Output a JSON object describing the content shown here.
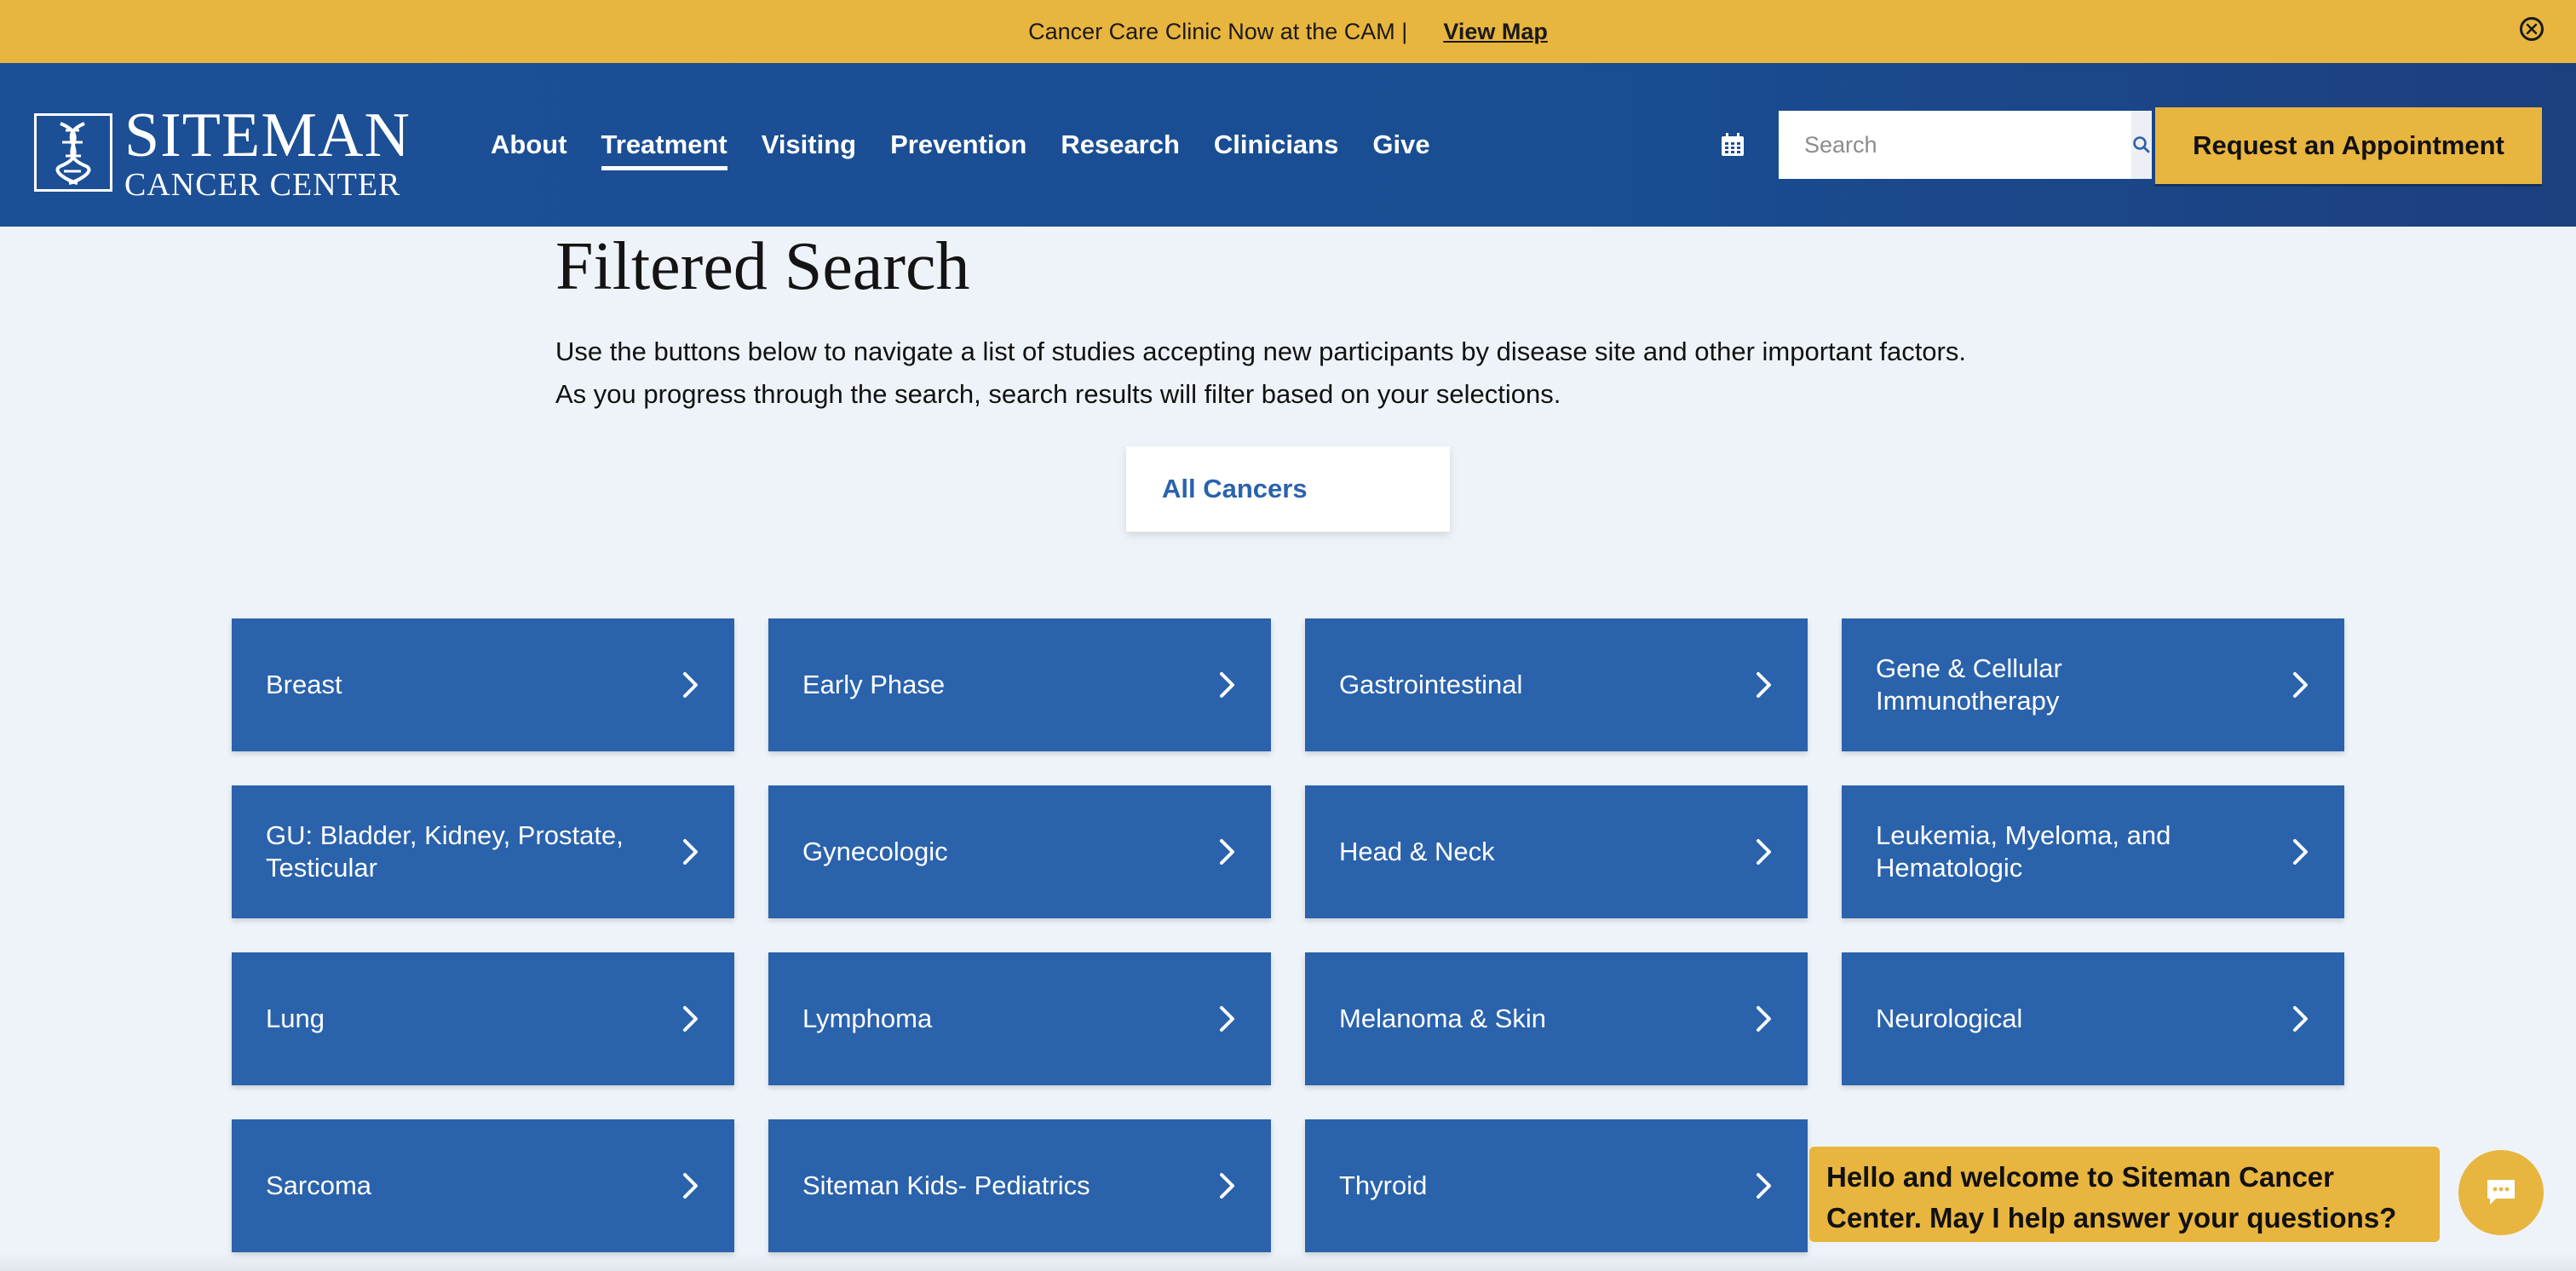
{
  "announcement": {
    "message": "Cancer Care Clinic Now at the CAM |",
    "link_label": "View Map"
  },
  "header": {
    "logo_line1": "SITEMAN",
    "logo_line2": "CANCER CENTER",
    "nav": [
      {
        "label": "About"
      },
      {
        "label": "Treatment",
        "active": true
      },
      {
        "label": "Visiting"
      },
      {
        "label": "Prevention"
      },
      {
        "label": "Research"
      },
      {
        "label": "Clinicians"
      },
      {
        "label": "Give"
      }
    ],
    "search_placeholder": "Search",
    "appointment_label": "Request an Appointment"
  },
  "main": {
    "title": "Filtered Search",
    "description": "Use the buttons below to navigate a list of studies accepting new participants by disease site and other important factors. As you progress through the search, search results will filter based on your selections.",
    "all_cancers_label": "All Cancers",
    "tiles": [
      {
        "label": "Breast"
      },
      {
        "label": "Early Phase"
      },
      {
        "label": "Gastrointestinal"
      },
      {
        "label": "Gene & Cellular Immunotherapy"
      },
      {
        "label": "GU: Bladder, Kidney, Prostate, Testicular"
      },
      {
        "label": "Gynecologic"
      },
      {
        "label": "Head & Neck"
      },
      {
        "label": "Leukemia, Myeloma, and Hematologic"
      },
      {
        "label": "Lung"
      },
      {
        "label": "Lymphoma"
      },
      {
        "label": "Melanoma & Skin"
      },
      {
        "label": "Neurological"
      },
      {
        "label": "Sarcoma"
      },
      {
        "label": "Siteman Kids- Pediatrics"
      },
      {
        "label": "Thyroid"
      }
    ]
  },
  "chat": {
    "message": "Hello and welcome to Siteman Cancer Center. May I help answer your questions?"
  },
  "colors": {
    "brand_blue": "#2a62ac",
    "header_blue": "#1c4f96",
    "accent_gold": "#e8b53f",
    "page_bg": "#eef3f9"
  },
  "icons": [
    "close-circle-icon",
    "dna-logo-icon",
    "calendar-icon",
    "search-icon",
    "chevron-right-icon",
    "chat-icon"
  ]
}
